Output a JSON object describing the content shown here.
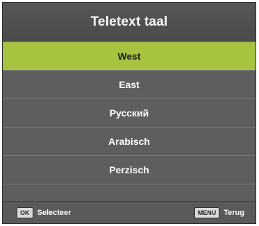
{
  "menu": {
    "title": "Teletext taal",
    "selected_index": 0,
    "items": [
      {
        "label": "West"
      },
      {
        "label": "East"
      },
      {
        "label": "Русский"
      },
      {
        "label": "Arabisch"
      },
      {
        "label": "Perzisch"
      },
      {
        "label": ""
      }
    ]
  },
  "footer": {
    "ok_key": "OK",
    "ok_label": "Selecteer",
    "menu_key": "MENU",
    "menu_label": "Terug"
  },
  "colors": {
    "selected_row": "#a7c440",
    "panel": "#5e5e5e"
  }
}
